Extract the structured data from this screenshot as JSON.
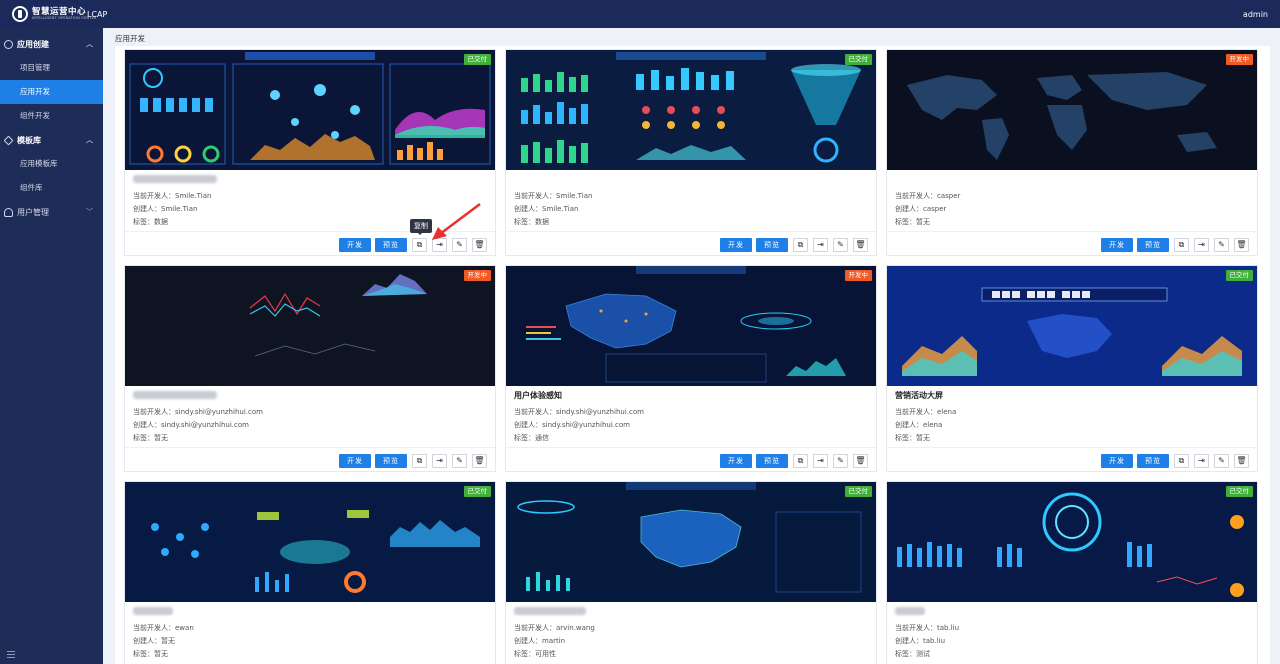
{
  "header": {
    "logo_title": "智慧运营中心",
    "logo_sub": "INTELLIGENT OPERATION CENTER",
    "app_name": "LCAP",
    "user": "admin"
  },
  "sidebar": {
    "groups": [
      {
        "label": "应用创建",
        "items": [
          "项目管理",
          "应用开发",
          "组件开发"
        ]
      },
      {
        "label": "模板库",
        "items": [
          "应用模板库",
          "组件库"
        ]
      },
      {
        "label": "用户管理",
        "items": []
      }
    ],
    "active_item": "应用开发"
  },
  "breadcrumb": "应用开发",
  "labels": {
    "developer": "当前开发人：",
    "creator": "创建人：",
    "tag": "标签：",
    "btn_dev": "开发",
    "btn_preview": "预览",
    "tooltip_copy": "复制"
  },
  "cards": [
    {
      "name": "",
      "status": "已交付",
      "status_color": "#40b03a",
      "developer": "Smile.Tian",
      "creator": "Smile.Tian",
      "tag": "数据"
    },
    {
      "name": "",
      "status": "已交付",
      "status_color": "#40b03a",
      "developer": "Smile.Tian",
      "creator": "Smile.Tian",
      "tag": "数据"
    },
    {
      "name": "",
      "status": "开发中",
      "status_color": "#f05a24",
      "developer": "casper",
      "creator": "casper",
      "tag": "暂无"
    },
    {
      "name": "",
      "status": "开发中",
      "status_color": "#f05a24",
      "developer": "sindy.shi@yunzhihui.com",
      "creator": "sindy.shi@yunzhihui.com",
      "tag": "暂无"
    },
    {
      "name": "用户体验感知",
      "status": "开发中",
      "status_color": "#f05a24",
      "developer": "sindy.shi@yunzhihui.com",
      "creator": "sindy.shi@yunzhihui.com",
      "tag": "通信"
    },
    {
      "name": "营销活动大屏",
      "status": "已交付",
      "status_color": "#40b03a",
      "developer": "elena",
      "creator": "elena",
      "tag": "暂无"
    },
    {
      "name": "",
      "status": "已交付",
      "status_color": "#40b03a",
      "developer": "ewan",
      "creator": "暂无",
      "tag": "暂无"
    },
    {
      "name": "",
      "status": "已交付",
      "status_color": "#40b03a",
      "developer": "arvin.wang",
      "creator": "martin",
      "tag": "可用性"
    },
    {
      "name": "",
      "status": "已交付",
      "status_color": "#40b03a",
      "developer": "tab.liu",
      "creator": "tab.liu",
      "tag": "测试"
    }
  ],
  "icons": [
    "copy-icon",
    "export-icon",
    "edit-icon",
    "delete-icon"
  ],
  "colors": {
    "primary": "#1e7fe6",
    "sidebar": "#1e2c58",
    "topbar": "#1b2a5a",
    "delivered": "#40b03a",
    "developing": "#f05a24",
    "annotation_arrow": "#e8312a"
  }
}
